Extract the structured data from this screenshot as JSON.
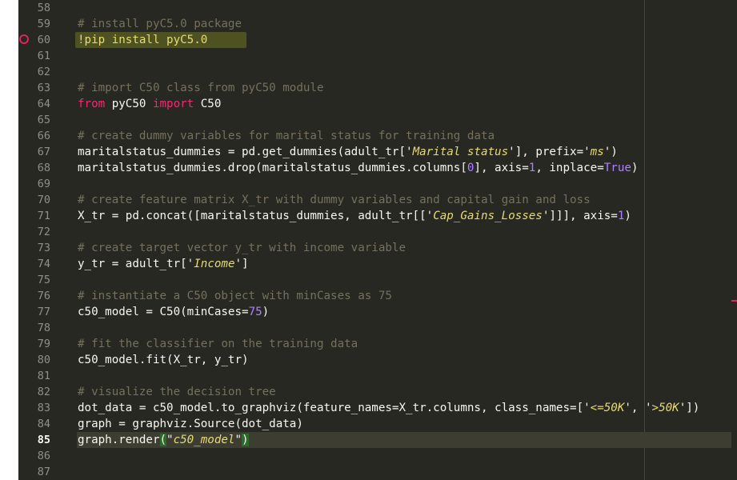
{
  "editor": {
    "lines": [
      {
        "num": "58",
        "text": ""
      },
      {
        "num": "59",
        "text": "# install pyC5.0 package"
      },
      {
        "num": "60",
        "text": "!pip install pyC5.0"
      },
      {
        "num": "61",
        "text": ""
      },
      {
        "num": "62",
        "text": ""
      },
      {
        "num": "63",
        "text": "# import C50 class from pyC50 module"
      },
      {
        "num": "64",
        "text": "from pyC50 import C50"
      },
      {
        "num": "65",
        "text": ""
      },
      {
        "num": "66",
        "text": "# create dummy variables for marital status for training data"
      },
      {
        "num": "67",
        "text": "maritalstatus_dummies = pd.get_dummies(adult_tr['Marital status'], prefix='ms')"
      },
      {
        "num": "68",
        "text": "maritalstatus_dummies.drop(maritalstatus_dummies.columns[0], axis=1, inplace=True)"
      },
      {
        "num": "69",
        "text": ""
      },
      {
        "num": "70",
        "text": "# create feature matrix X_tr with dummy variables and capital gain and loss"
      },
      {
        "num": "71",
        "text": "X_tr = pd.concat([maritalstatus_dummies, adult_tr[['Cap_Gains_Losses']]], axis=1)"
      },
      {
        "num": "72",
        "text": ""
      },
      {
        "num": "73",
        "text": "# create target vector y_tr with income variable"
      },
      {
        "num": "74",
        "text": "y_tr = adult_tr['Income']"
      },
      {
        "num": "75",
        "text": ""
      },
      {
        "num": "76",
        "text": "# instantiate a C50 object with minCases as 75"
      },
      {
        "num": "77",
        "text": "c50_model = C50(minCases=75)"
      },
      {
        "num": "78",
        "text": ""
      },
      {
        "num": "79",
        "text": "# fit the classifier on the training data"
      },
      {
        "num": "80",
        "text": "c50_model.fit(X_tr, y_tr)"
      },
      {
        "num": "81",
        "text": ""
      },
      {
        "num": "82",
        "text": "# visualize the decision tree"
      },
      {
        "num": "83",
        "text": "dot_data = c50_model.to_graphviz(feature_names=X_tr.columns, class_names=['<=50K', '>50K'])"
      },
      {
        "num": "84",
        "text": "graph = graphviz.Source(dot_data)"
      },
      {
        "num": "85",
        "text": "graph.render(\"c50_model\")"
      },
      {
        "num": "86",
        "text": ""
      },
      {
        "num": "87",
        "text": ""
      }
    ],
    "current_line": "85",
    "breakpoint_line": "60"
  },
  "colors": {
    "background": "#272822",
    "comment": "#75715e",
    "keyword": "#f92672",
    "string": "#e6db74",
    "number": "#ae81ff",
    "text": "#f8f8f2"
  }
}
